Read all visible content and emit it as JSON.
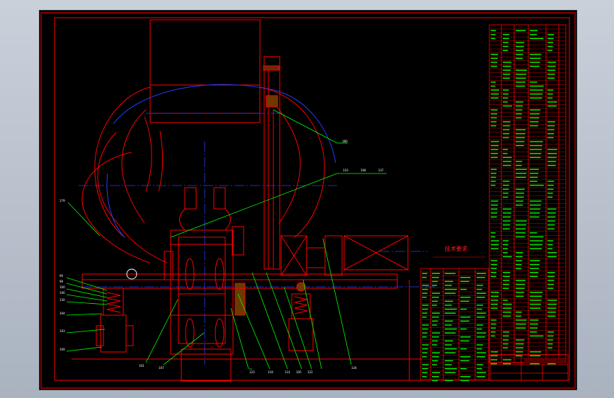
{
  "drawing": {
    "tech_title": "技术要求",
    "colors": {
      "background": "#000000",
      "frame": "#ff0000",
      "leader": "#00ff00",
      "centerline": "#2a3cff",
      "text": "#ffffff",
      "table_text": "#00ff00"
    },
    "callouts": [
      "180",
      "110",
      "108",
      "137",
      "179",
      "90",
      "99",
      "100",
      "106",
      "130",
      "104",
      "103",
      "109",
      "101",
      "107",
      "123",
      "118",
      "114",
      "105",
      "122",
      "134"
    ]
  }
}
